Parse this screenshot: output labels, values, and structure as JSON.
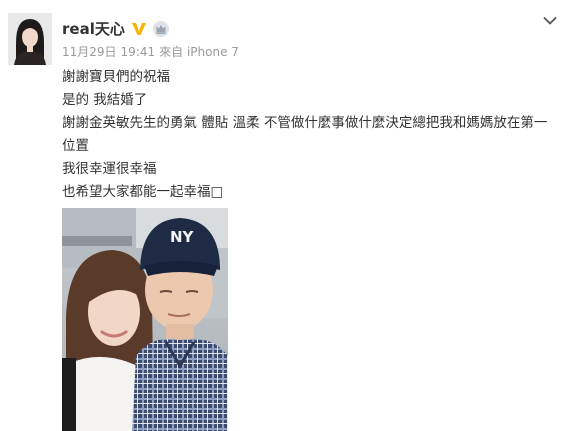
{
  "post": {
    "username": "real天心",
    "date": "11月29日",
    "time": "19:41",
    "source": "來自 iPhone 7",
    "lines": [
      "謝謝寶貝們的祝福",
      "是的 我結婚了",
      "謝謝金英敏先生的勇氣 體貼 溫柔 不管做什麼事做什麼決定總把我和媽媽放在第一位置",
      "我很幸運很幸福",
      "也希望大家都能一起幸福□"
    ],
    "photo": {
      "cap_logo": "NY"
    }
  },
  "icons": {
    "verified": "verified-v-icon",
    "member": "member-crown-icon",
    "menu": "chevron-down-icon"
  },
  "colors": {
    "username": "#333333",
    "meta": "#999999",
    "verified": "#f5b400"
  }
}
